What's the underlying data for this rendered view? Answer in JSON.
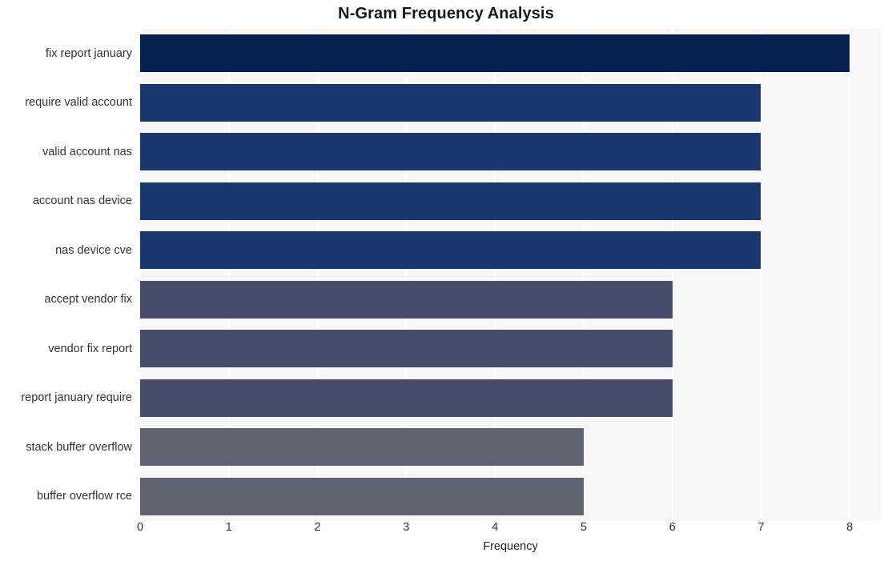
{
  "chart_data": {
    "type": "bar",
    "orientation": "horizontal",
    "title": "N-Gram Frequency Analysis",
    "xlabel": "Frequency",
    "ylabel": "",
    "xlim": [
      0,
      8.35
    ],
    "xticks": [
      0,
      1,
      2,
      3,
      4,
      5,
      6,
      7,
      8
    ],
    "xtick_labels": [
      "0",
      "1",
      "2",
      "3",
      "4",
      "5",
      "6",
      "7",
      "8"
    ],
    "grid": "vertical-white-on-light-gray",
    "legend": "none",
    "categories": [
      "fix report january",
      "require valid account",
      "valid account nas",
      "account nas device",
      "nas device cve",
      "accept vendor fix",
      "vendor fix report",
      "report january require",
      "stack buffer overflow",
      "buffer overflow rce"
    ],
    "values": [
      8,
      7,
      7,
      7,
      7,
      6,
      6,
      6,
      5,
      5
    ],
    "bar_colors": [
      "#042150",
      "#1b376f",
      "#1b376f",
      "#1b376f",
      "#1b376f",
      "#454d6b",
      "#454d6b",
      "#454d6b",
      "#5f636f",
      "#5f636f"
    ]
  },
  "style": {
    "plot_background": "#f7f7f8",
    "figure_background": "#ffffff",
    "gridline_color": "#ffffff",
    "tick_label_color": "#333333",
    "title_color": "#18181b"
  }
}
